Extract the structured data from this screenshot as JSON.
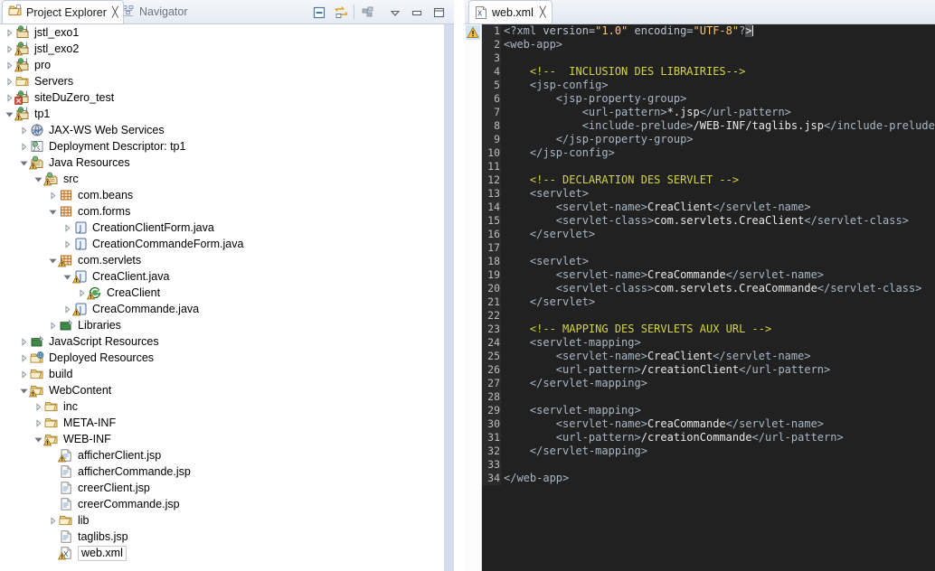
{
  "left_panel": {
    "tabs": [
      {
        "label": "Project Explorer",
        "icon": "project-explorer-icon",
        "close": "╳",
        "active": true
      },
      {
        "label": "Navigator",
        "icon": "navigator-icon",
        "active": false
      }
    ],
    "toolbar": [
      {
        "name": "collapse-all-button",
        "icon": "collapse-all-icon"
      },
      {
        "name": "link-with-editor-button",
        "icon": "link-editor-icon"
      },
      {
        "name": "view-menu-filters-button",
        "icon": "filters-icon"
      },
      {
        "name": "view-menu-button",
        "icon": "chevron-down-icon"
      },
      {
        "name": "minimize-button",
        "icon": "minimize-icon"
      },
      {
        "name": "maximize-button",
        "icon": "maximize-icon"
      }
    ],
    "tree": [
      {
        "label": "jstl_exo1",
        "depth": 0,
        "arrow": "collapsed",
        "icon": "web-project-icon",
        "warn": false,
        "err": false
      },
      {
        "label": "jstl_exo2",
        "depth": 0,
        "arrow": "collapsed",
        "icon": "web-project-icon",
        "warn": true,
        "err": false
      },
      {
        "label": "pro",
        "depth": 0,
        "arrow": "collapsed",
        "icon": "web-project-icon",
        "warn": true,
        "err": false
      },
      {
        "label": "Servers",
        "depth": 0,
        "arrow": "collapsed",
        "icon": "folder-icon",
        "warn": false,
        "err": false
      },
      {
        "label": "siteDuZero_test",
        "depth": 0,
        "arrow": "collapsed",
        "icon": "web-project-icon",
        "warn": false,
        "err": true
      },
      {
        "label": "tp1",
        "depth": 0,
        "arrow": "expanded",
        "icon": "web-project-icon",
        "warn": true,
        "err": false
      },
      {
        "label": "JAX-WS Web Services",
        "depth": 1,
        "arrow": "collapsed",
        "icon": "jaxws-icon",
        "warn": false,
        "err": false
      },
      {
        "label": "Deployment Descriptor: tp1",
        "depth": 1,
        "arrow": "collapsed",
        "icon": "deployment-descriptor-icon",
        "warn": false,
        "err": false
      },
      {
        "label": "Java Resources",
        "depth": 1,
        "arrow": "expanded",
        "icon": "java-resources-icon",
        "warn": true,
        "err": false
      },
      {
        "label": "src",
        "depth": 2,
        "arrow": "expanded",
        "icon": "source-folder-icon",
        "warn": true,
        "err": false
      },
      {
        "label": "com.beans",
        "depth": 3,
        "arrow": "collapsed",
        "icon": "package-icon",
        "warn": false,
        "err": false
      },
      {
        "label": "com.forms",
        "depth": 3,
        "arrow": "expanded",
        "icon": "package-icon",
        "warn": false,
        "err": false
      },
      {
        "label": "CreationClientForm.java",
        "depth": 4,
        "arrow": "collapsed",
        "icon": "java-file-icon",
        "warn": false,
        "err": false
      },
      {
        "label": "CreationCommandeForm.java",
        "depth": 4,
        "arrow": "collapsed",
        "icon": "java-file-icon",
        "warn": false,
        "err": false
      },
      {
        "label": "com.servlets",
        "depth": 3,
        "arrow": "expanded",
        "icon": "package-icon",
        "warn": true,
        "err": false
      },
      {
        "label": "CreaClient.java",
        "depth": 4,
        "arrow": "expanded",
        "icon": "java-file-icon",
        "warn": true,
        "err": false
      },
      {
        "label": "CreaClient",
        "depth": 5,
        "arrow": "collapsed",
        "icon": "java-class-icon",
        "warn": true,
        "err": false
      },
      {
        "label": "CreaCommande.java",
        "depth": 4,
        "arrow": "collapsed",
        "icon": "java-file-icon",
        "warn": true,
        "err": false
      },
      {
        "label": "Libraries",
        "depth": 3,
        "arrow": "collapsed",
        "icon": "libraries-icon",
        "warn": false,
        "err": false
      },
      {
        "label": "JavaScript Resources",
        "depth": 1,
        "arrow": "collapsed",
        "icon": "libraries-icon",
        "warn": false,
        "err": false
      },
      {
        "label": "Deployed Resources",
        "depth": 1,
        "arrow": "collapsed",
        "icon": "deployed-resources-icon",
        "warn": false,
        "err": false
      },
      {
        "label": "build",
        "depth": 1,
        "arrow": "collapsed",
        "icon": "folder-icon",
        "warn": false,
        "err": false
      },
      {
        "label": "WebContent",
        "depth": 1,
        "arrow": "expanded",
        "icon": "folder-icon",
        "warn": true,
        "err": false
      },
      {
        "label": "inc",
        "depth": 2,
        "arrow": "collapsed",
        "icon": "folder-icon",
        "warn": false,
        "err": false
      },
      {
        "label": "META-INF",
        "depth": 2,
        "arrow": "collapsed",
        "icon": "folder-icon",
        "warn": false,
        "err": false
      },
      {
        "label": "WEB-INF",
        "depth": 2,
        "arrow": "expanded",
        "icon": "folder-icon",
        "warn": true,
        "err": false
      },
      {
        "label": "afficherClient.jsp",
        "depth": 3,
        "arrow": "none",
        "icon": "jsp-file-icon",
        "warn": true,
        "err": false
      },
      {
        "label": "afficherCommande.jsp",
        "depth": 3,
        "arrow": "none",
        "icon": "jsp-file-icon",
        "warn": false,
        "err": false
      },
      {
        "label": "creerClient.jsp",
        "depth": 3,
        "arrow": "none",
        "icon": "jsp-file-icon",
        "warn": false,
        "err": false
      },
      {
        "label": "creerCommande.jsp",
        "depth": 3,
        "arrow": "none",
        "icon": "jsp-file-icon",
        "warn": false,
        "err": false
      },
      {
        "label": "lib",
        "depth": 3,
        "arrow": "collapsed",
        "icon": "folder-icon",
        "warn": false,
        "err": false
      },
      {
        "label": "taglibs.jsp",
        "depth": 3,
        "arrow": "none",
        "icon": "jsp-file-icon",
        "warn": false,
        "err": false
      },
      {
        "label": "web.xml",
        "depth": 3,
        "arrow": "none",
        "icon": "xml-file-icon",
        "warn": true,
        "err": false,
        "selected": true
      }
    ]
  },
  "editor": {
    "tab": {
      "label": "web.xml",
      "icon": "xml-file-icon",
      "close": "╳"
    },
    "marker": {
      "name": "warning-marker",
      "icon": "warning-icon"
    },
    "colors": {
      "background": "#212121",
      "gutter": "#2b2b2b",
      "tag": "#a9b7c6",
      "comment": "#d4d44a",
      "attribute_value": "#ffc66d",
      "text": "#e8e8e8"
    },
    "first_line": 1,
    "last_line": 34,
    "lines": [
      {
        "n": 1,
        "segments": [
          {
            "c": "tag",
            "t": "<?xml "
          },
          {
            "c": "attr",
            "t": "version="
          },
          {
            "c": "val",
            "t": "\"1.0\""
          },
          {
            "c": "attr",
            "t": " encoding="
          },
          {
            "c": "val",
            "t": "\"UTF-8\""
          },
          {
            "c": "tag",
            "t": "?"
          },
          {
            "c": "brkt",
            "t": ">"
          }
        ]
      },
      {
        "n": 2,
        "segments": [
          {
            "c": "tag",
            "t": "<web-app>"
          }
        ]
      },
      {
        "n": 3,
        "segments": []
      },
      {
        "n": 4,
        "segments": [
          {
            "c": "cmt",
            "t": "    <!--  INCLUSION DES LIBRAIRIES-->"
          }
        ]
      },
      {
        "n": 5,
        "segments": [
          {
            "c": "tag",
            "t": "    <jsp-config>"
          }
        ]
      },
      {
        "n": 6,
        "segments": [
          {
            "c": "tag",
            "t": "        <jsp-property-group>"
          }
        ]
      },
      {
        "n": 7,
        "segments": [
          {
            "c": "tag",
            "t": "            <url-pattern>"
          },
          {
            "c": "txt",
            "t": "*.jsp"
          },
          {
            "c": "tag",
            "t": "</url-pattern>"
          }
        ]
      },
      {
        "n": 8,
        "segments": [
          {
            "c": "tag",
            "t": "            <include-prelude>"
          },
          {
            "c": "txt",
            "t": "/WEB-INF/taglibs.jsp"
          },
          {
            "c": "tag",
            "t": "</include-prelude>"
          }
        ]
      },
      {
        "n": 9,
        "segments": [
          {
            "c": "tag",
            "t": "        </jsp-property-group>"
          }
        ]
      },
      {
        "n": 10,
        "segments": [
          {
            "c": "tag",
            "t": "    </jsp-config>"
          }
        ]
      },
      {
        "n": 11,
        "segments": []
      },
      {
        "n": 12,
        "segments": [
          {
            "c": "cmt",
            "t": "    <!-- DECLARATION DES SERVLET -->"
          }
        ]
      },
      {
        "n": 13,
        "segments": [
          {
            "c": "tag",
            "t": "    <servlet>"
          }
        ]
      },
      {
        "n": 14,
        "segments": [
          {
            "c": "tag",
            "t": "        <servlet-name>"
          },
          {
            "c": "txt",
            "t": "CreaClient"
          },
          {
            "c": "tag",
            "t": "</servlet-name>"
          }
        ]
      },
      {
        "n": 15,
        "segments": [
          {
            "c": "tag",
            "t": "        <servlet-class>"
          },
          {
            "c": "txt",
            "t": "com.servlets.CreaClient"
          },
          {
            "c": "tag",
            "t": "</servlet-class>"
          }
        ]
      },
      {
        "n": 16,
        "segments": [
          {
            "c": "tag",
            "t": "    </servlet>"
          }
        ]
      },
      {
        "n": 17,
        "segments": []
      },
      {
        "n": 18,
        "segments": [
          {
            "c": "tag",
            "t": "    <servlet>"
          }
        ]
      },
      {
        "n": 19,
        "segments": [
          {
            "c": "tag",
            "t": "        <servlet-name>"
          },
          {
            "c": "txt",
            "t": "CreaCommande"
          },
          {
            "c": "tag",
            "t": "</servlet-name>"
          }
        ]
      },
      {
        "n": 20,
        "segments": [
          {
            "c": "tag",
            "t": "        <servlet-class>"
          },
          {
            "c": "txt",
            "t": "com.servlets.CreaCommande"
          },
          {
            "c": "tag",
            "t": "</servlet-class>"
          }
        ]
      },
      {
        "n": 21,
        "segments": [
          {
            "c": "tag",
            "t": "    </servlet>"
          }
        ]
      },
      {
        "n": 22,
        "segments": []
      },
      {
        "n": 23,
        "segments": [
          {
            "c": "cmt",
            "t": "    <!-- MAPPING DES SERVLETS AUX URL -->"
          }
        ]
      },
      {
        "n": 24,
        "segments": [
          {
            "c": "tag",
            "t": "    <servlet-mapping>"
          }
        ]
      },
      {
        "n": 25,
        "segments": [
          {
            "c": "tag",
            "t": "        <servlet-name>"
          },
          {
            "c": "txt",
            "t": "CreaClient"
          },
          {
            "c": "tag",
            "t": "</servlet-name>"
          }
        ]
      },
      {
        "n": 26,
        "segments": [
          {
            "c": "tag",
            "t": "        <url-pattern>"
          },
          {
            "c": "txt",
            "t": "/creationClient"
          },
          {
            "c": "tag",
            "t": "</url-pattern>"
          }
        ]
      },
      {
        "n": 27,
        "segments": [
          {
            "c": "tag",
            "t": "    </servlet-mapping>"
          }
        ]
      },
      {
        "n": 28,
        "segments": []
      },
      {
        "n": 29,
        "segments": [
          {
            "c": "tag",
            "t": "    <servlet-mapping>"
          }
        ]
      },
      {
        "n": 30,
        "segments": [
          {
            "c": "tag",
            "t": "        <servlet-name>"
          },
          {
            "c": "txt",
            "t": "CreaCommande"
          },
          {
            "c": "tag",
            "t": "</servlet-name>"
          }
        ]
      },
      {
        "n": 31,
        "segments": [
          {
            "c": "tag",
            "t": "        <url-pattern>"
          },
          {
            "c": "txt",
            "t": "/creationCommande"
          },
          {
            "c": "tag",
            "t": "</url-pattern>"
          }
        ]
      },
      {
        "n": 32,
        "segments": [
          {
            "c": "tag",
            "t": "    </servlet-mapping>"
          }
        ]
      },
      {
        "n": 33,
        "segments": []
      },
      {
        "n": 34,
        "segments": [
          {
            "c": "tag",
            "t": "</web-app>"
          }
        ]
      }
    ]
  }
}
